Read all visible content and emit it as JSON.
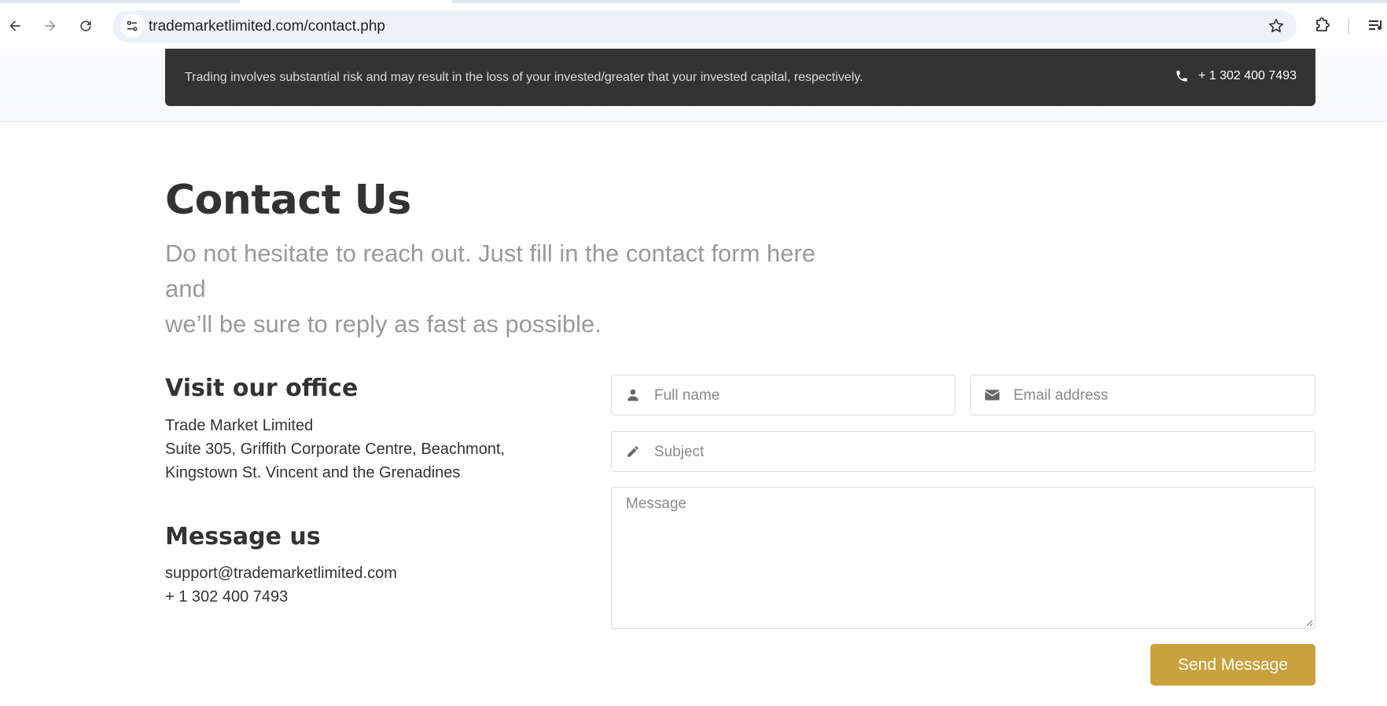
{
  "browser": {
    "url": "trademarketlimited.com/contact.php"
  },
  "risk_bar": {
    "text": "Trading involves substantial risk and may result in the loss of your invested/greater that your invested capital, respectively.",
    "phone": "+ 1 302 400 7493"
  },
  "page": {
    "title": "Contact Us",
    "subtitle_line1": "Do not hesitate to reach out. Just fill in the contact form here and",
    "subtitle_line2": "we’ll be sure to reply as fast as possible."
  },
  "office": {
    "heading": "Visit our office",
    "company": "Trade Market Limited",
    "address_line1": "Suite 305, Griffith Corporate Centre, Beachmont,",
    "address_line2": "Kingstown St. Vincent and the Grenadines"
  },
  "message_us": {
    "heading": "Message us",
    "email": "support@trademarketlimited.com",
    "phone": "+ 1 302 400 7493"
  },
  "form": {
    "fullname_placeholder": "Full name",
    "email_placeholder": "Email address",
    "subject_placeholder": "Subject",
    "message_placeholder": "Message",
    "submit_label": "Send Message"
  },
  "colors": {
    "accent": "#c9a13d",
    "risk_bar_bg": "#333333"
  }
}
